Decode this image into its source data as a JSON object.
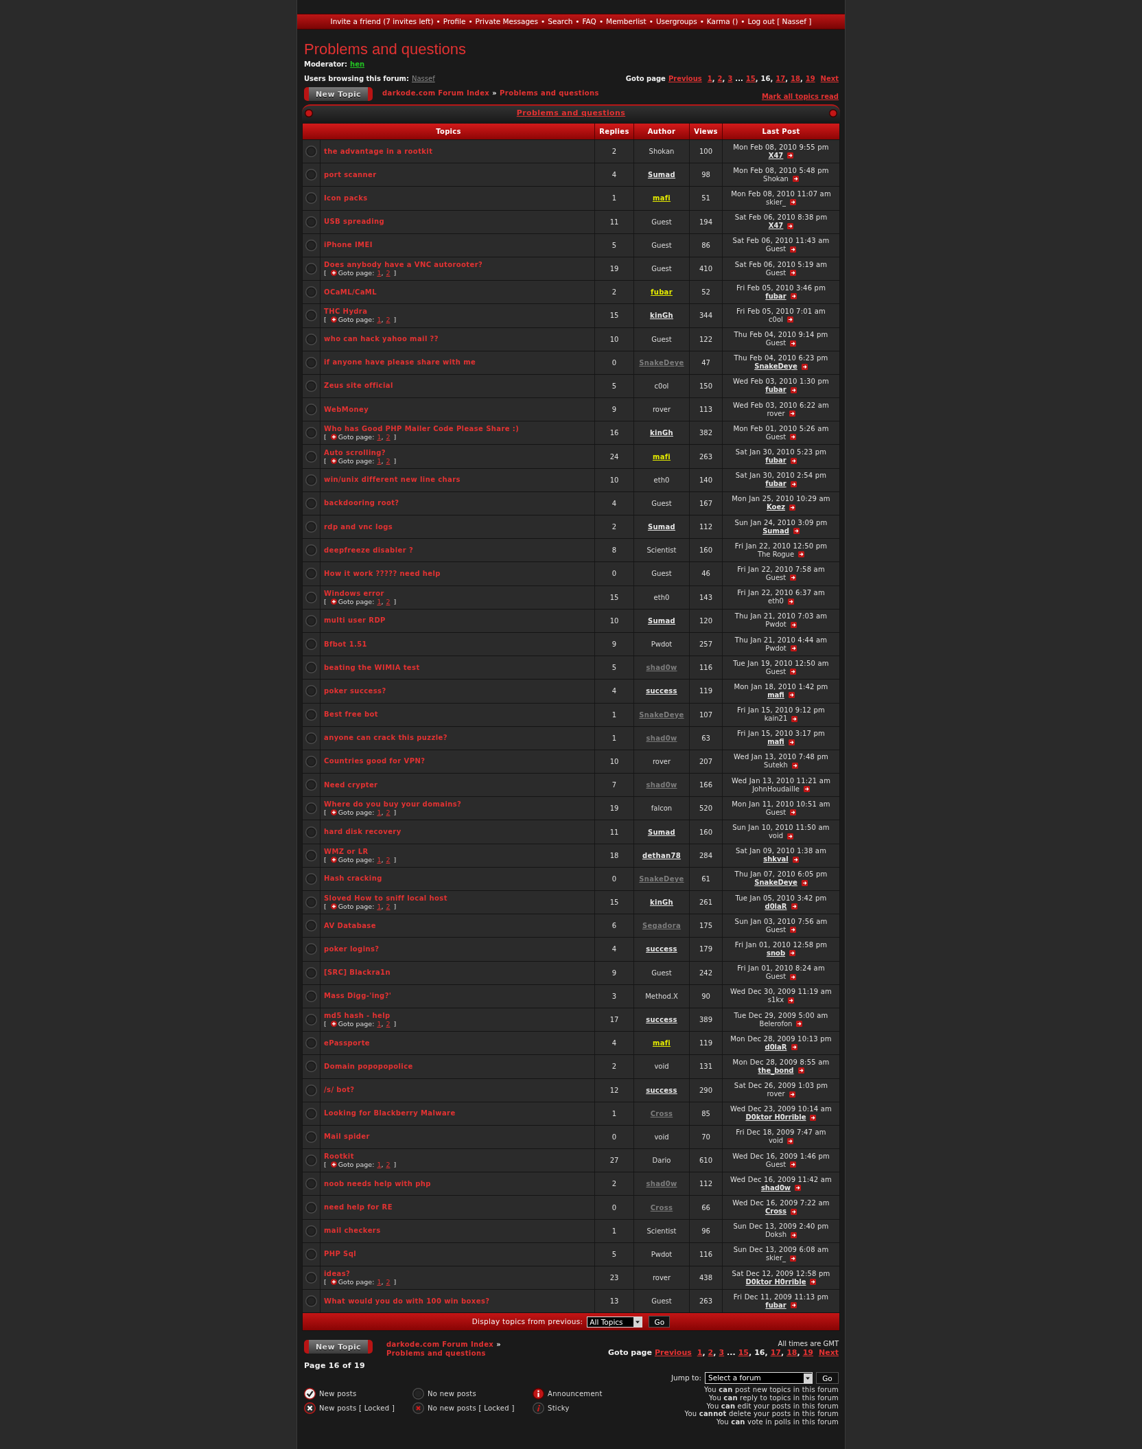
{
  "nav": {
    "links": [
      "Invite a friend (7 invites left)",
      "Profile",
      "Private Messages",
      "Search",
      "FAQ",
      "Memberlist",
      "Usergroups",
      "Karma ()",
      "Log out [ Nassef ]"
    ],
    "separator": "•"
  },
  "forum_title": "Problems and questions",
  "moderator": {
    "label": "Moderator:",
    "name": "hen"
  },
  "users_browsing": {
    "label": "Users browsing this forum:",
    "names": [
      "Nassef"
    ]
  },
  "pagination_top": {
    "label": "Goto page",
    "previous": "Previous",
    "next": "Next",
    "separator": ",",
    "items": [
      {
        "kind": "page",
        "label": "1",
        "selected": false
      },
      {
        "kind": "page",
        "label": "2",
        "selected": false
      },
      {
        "kind": "page",
        "label": "3",
        "selected": false
      },
      {
        "kind": "gap",
        "label": "..."
      },
      {
        "kind": "page",
        "label": "15",
        "selected": false
      },
      {
        "kind": "page",
        "label": "16",
        "selected": true
      },
      {
        "kind": "page",
        "label": "17",
        "selected": false
      },
      {
        "kind": "page",
        "label": "18",
        "selected": false
      },
      {
        "kind": "page",
        "label": "19",
        "selected": false
      }
    ]
  },
  "new_topic_top": "New Topic",
  "breadcrumb_top": {
    "items": [
      "darkode.com Forum Index",
      "Problems and questions"
    ],
    "separator": "»"
  },
  "mark_read": "Mark all topics read",
  "topics": {
    "title": "Problems and questions",
    "columns": [
      "Topics",
      "Replies",
      "Author",
      "Views",
      "Last Post"
    ],
    "rows": [
      {
        "title": "the advantage in a rootkit",
        "replies": "2",
        "author": {
          "name": "Shokan",
          "linked": false
        },
        "views": "100",
        "last_post": {
          "date": "Mon Feb 08, 2010 9:55 pm",
          "author": "X47",
          "linked": true
        }
      },
      {
        "title": "port scanner",
        "replies": "4",
        "author": {
          "name": "Sumad",
          "linked": true,
          "color": "#e6e6e6"
        },
        "views": "98",
        "last_post": {
          "date": "Mon Feb 08, 2010 5:48 pm",
          "author": "Shokan",
          "linked": false
        }
      },
      {
        "title": "Icon packs",
        "replies": "1",
        "author": {
          "name": "mafi",
          "linked": true,
          "color": "#e5ec00"
        },
        "views": "51",
        "last_post": {
          "date": "Mon Feb 08, 2010 11:07 am",
          "author": "skier_",
          "linked": false
        }
      },
      {
        "title": "USB spreading",
        "replies": "11",
        "author": {
          "name": "Guest",
          "linked": false
        },
        "views": "194",
        "last_post": {
          "date": "Sat Feb 06, 2010 8:38 pm",
          "author": "X47",
          "linked": true
        }
      },
      {
        "title": "iPhone IMEI",
        "replies": "5",
        "author": {
          "name": "Guest",
          "linked": false
        },
        "views": "86",
        "last_post": {
          "date": "Sat Feb 06, 2010 11:43 am",
          "author": "Guest",
          "linked": false
        }
      },
      {
        "title": "Does anybody have a VNC autorooter?",
        "goto": {
          "open": "[",
          "label": "Goto page:",
          "pages": [
            "1",
            "2"
          ],
          "separator": ",",
          "close": "]"
        },
        "replies": "19",
        "author": {
          "name": "Guest",
          "linked": false
        },
        "views": "410",
        "last_post": {
          "date": "Sat Feb 06, 2010 5:19 am",
          "author": "Guest",
          "linked": false
        }
      },
      {
        "title": "OCaML/CaML",
        "replies": "2",
        "author": {
          "name": "fubar",
          "linked": true,
          "color": "#e5ec00"
        },
        "views": "52",
        "last_post": {
          "date": "Fri Feb 05, 2010 3:46 pm",
          "author": "fubar",
          "linked": true
        }
      },
      {
        "title": "THC Hydra",
        "goto": {
          "open": "[",
          "label": "Goto page:",
          "pages": [
            "1",
            "2"
          ],
          "separator": ",",
          "close": "]"
        },
        "replies": "15",
        "author": {
          "name": "kinGh",
          "linked": true,
          "color": "#e6e6e6"
        },
        "views": "344",
        "last_post": {
          "date": "Fri Feb 05, 2010 7:01 am",
          "author": "c0ol",
          "linked": false
        }
      },
      {
        "title": "who can hack yahoo mail ??",
        "replies": "10",
        "author": {
          "name": "Guest",
          "linked": false
        },
        "views": "122",
        "last_post": {
          "date": "Thu Feb 04, 2010 9:14 pm",
          "author": "Guest",
          "linked": false
        }
      },
      {
        "title": "if anyone have please share with me",
        "replies": "0",
        "author": {
          "name": "SnakeDeye",
          "linked": true,
          "color": "#7c7c7c"
        },
        "views": "47",
        "last_post": {
          "date": "Thu Feb 04, 2010 6:23 pm",
          "author": "SnakeDeye",
          "linked": true
        }
      },
      {
        "title": "Zeus site official",
        "replies": "5",
        "author": {
          "name": "c0ol",
          "linked": false
        },
        "views": "150",
        "last_post": {
          "date": "Wed Feb 03, 2010 1:30 pm",
          "author": "fubar",
          "linked": true
        }
      },
      {
        "title": "WebMoney",
        "replies": "9",
        "author": {
          "name": "rover",
          "linked": false
        },
        "views": "113",
        "last_post": {
          "date": "Wed Feb 03, 2010 6:22 am",
          "author": "rover",
          "linked": false
        }
      },
      {
        "title": "Who has Good PHP Mailer Code Please Share :)",
        "goto": {
          "open": "[",
          "label": "Goto page:",
          "pages": [
            "1",
            "2"
          ],
          "separator": ",",
          "close": "]"
        },
        "replies": "16",
        "author": {
          "name": "kinGh",
          "linked": true,
          "color": "#e6e6e6"
        },
        "views": "382",
        "last_post": {
          "date": "Mon Feb 01, 2010 5:26 am",
          "author": "Guest",
          "linked": false
        }
      },
      {
        "title": "Auto scrolling?",
        "goto": {
          "open": "[",
          "label": "Goto page:",
          "pages": [
            "1",
            "2"
          ],
          "separator": ",",
          "close": "]"
        },
        "replies": "24",
        "author": {
          "name": "mafi",
          "linked": true,
          "color": "#e5ec00"
        },
        "views": "263",
        "last_post": {
          "date": "Sat Jan 30, 2010 5:23 pm",
          "author": "fubar",
          "linked": true
        }
      },
      {
        "title": "win/unix different new line chars",
        "replies": "10",
        "author": {
          "name": "eth0",
          "linked": false
        },
        "views": "140",
        "last_post": {
          "date": "Sat Jan 30, 2010 2:54 pm",
          "author": "fubar",
          "linked": true
        }
      },
      {
        "title": "backdooring root?",
        "replies": "4",
        "author": {
          "name": "Guest",
          "linked": false
        },
        "views": "167",
        "last_post": {
          "date": "Mon Jan 25, 2010 10:29 am",
          "author": "Koez",
          "linked": true
        }
      },
      {
        "title": "rdp and vnc logs",
        "replies": "2",
        "author": {
          "name": "Sumad",
          "linked": true,
          "color": "#e6e6e6"
        },
        "views": "112",
        "last_post": {
          "date": "Sun Jan 24, 2010 3:09 pm",
          "author": "Sumad",
          "linked": true
        }
      },
      {
        "title": "deepfreeze disabler ?",
        "replies": "8",
        "author": {
          "name": "Scientist",
          "linked": false
        },
        "views": "160",
        "last_post": {
          "date": "Fri Jan 22, 2010 12:50 pm",
          "author": "The Rogue",
          "linked": false
        }
      },
      {
        "title": "How it work ????? need help",
        "replies": "0",
        "author": {
          "name": "Guest",
          "linked": false
        },
        "views": "46",
        "last_post": {
          "date": "Fri Jan 22, 2010 7:58 am",
          "author": "Guest",
          "linked": false
        }
      },
      {
        "title": "Windows error",
        "goto": {
          "open": "[",
          "label": "Goto page:",
          "pages": [
            "1",
            "2"
          ],
          "separator": ",",
          "close": "]"
        },
        "replies": "15",
        "author": {
          "name": "eth0",
          "linked": false
        },
        "views": "143",
        "last_post": {
          "date": "Fri Jan 22, 2010 6:37 am",
          "author": "eth0",
          "linked": false
        }
      },
      {
        "title": "multi user RDP",
        "replies": "10",
        "author": {
          "name": "Sumad",
          "linked": true,
          "color": "#e6e6e6"
        },
        "views": "120",
        "last_post": {
          "date": "Thu Jan 21, 2010 7:03 am",
          "author": "Pwdot",
          "linked": false
        }
      },
      {
        "title": "Bfbot 1.51",
        "replies": "9",
        "author": {
          "name": "Pwdot",
          "linked": false
        },
        "views": "257",
        "last_post": {
          "date": "Thu Jan 21, 2010 4:44 am",
          "author": "Pwdot",
          "linked": false
        }
      },
      {
        "title": "beating the WIMIA test",
        "replies": "5",
        "author": {
          "name": "shad0w",
          "linked": true,
          "color": "#7c7c7c"
        },
        "views": "116",
        "last_post": {
          "date": "Tue Jan 19, 2010 12:50 am",
          "author": "Guest",
          "linked": false
        }
      },
      {
        "title": "poker success?",
        "replies": "4",
        "author": {
          "name": "success",
          "linked": true,
          "color": "#e6e6e6"
        },
        "views": "119",
        "last_post": {
          "date": "Mon Jan 18, 2010 1:42 pm",
          "author": "mafi",
          "linked": true
        }
      },
      {
        "title": "Best free bot",
        "replies": "1",
        "author": {
          "name": "SnakeDeye",
          "linked": true,
          "color": "#7c7c7c"
        },
        "views": "107",
        "last_post": {
          "date": "Fri Jan 15, 2010 9:12 pm",
          "author": "kain21",
          "linked": false
        }
      },
      {
        "title": "anyone can crack this puzzle?",
        "replies": "1",
        "author": {
          "name": "shad0w",
          "linked": true,
          "color": "#7c7c7c"
        },
        "views": "63",
        "last_post": {
          "date": "Fri Jan 15, 2010 3:17 pm",
          "author": "mafi",
          "linked": true
        }
      },
      {
        "title": "Countries good for VPN?",
        "replies": "10",
        "author": {
          "name": "rover",
          "linked": false
        },
        "views": "207",
        "last_post": {
          "date": "Wed Jan 13, 2010 7:48 pm",
          "author": "Sutekh",
          "linked": false
        }
      },
      {
        "title": "Need crypter",
        "replies": "7",
        "author": {
          "name": "shad0w",
          "linked": true,
          "color": "#7c7c7c"
        },
        "views": "166",
        "last_post": {
          "date": "Wed Jan 13, 2010 11:21 am",
          "author": "JohnHoudaille",
          "linked": false
        }
      },
      {
        "title": "Where do you buy your domains?",
        "goto": {
          "open": "[",
          "label": "Goto page:",
          "pages": [
            "1",
            "2"
          ],
          "separator": ",",
          "close": "]"
        },
        "replies": "19",
        "author": {
          "name": "falcon",
          "linked": false
        },
        "views": "520",
        "last_post": {
          "date": "Mon Jan 11, 2010 10:51 am",
          "author": "Guest",
          "linked": false
        }
      },
      {
        "title": "hard disk recovery",
        "replies": "11",
        "author": {
          "name": "Sumad",
          "linked": true,
          "color": "#e6e6e6"
        },
        "views": "160",
        "last_post": {
          "date": "Sun Jan 10, 2010 11:50 am",
          "author": "void",
          "linked": false
        }
      },
      {
        "title": "WMZ or LR",
        "goto": {
          "open": "[",
          "label": "Goto page:",
          "pages": [
            "1",
            "2"
          ],
          "separator": ",",
          "close": "]"
        },
        "replies": "18",
        "author": {
          "name": "dethan78",
          "linked": true,
          "color": "#e6e6e6"
        },
        "views": "284",
        "last_post": {
          "date": "Sat Jan 09, 2010 1:38 am",
          "author": "shkval",
          "linked": true
        }
      },
      {
        "title": "Hash cracking",
        "replies": "0",
        "author": {
          "name": "SnakeDeye",
          "linked": true,
          "color": "#7c7c7c"
        },
        "views": "61",
        "last_post": {
          "date": "Thu Jan 07, 2010 6:05 pm",
          "author": "SnakeDeye",
          "linked": true
        }
      },
      {
        "title": "Sloved How to sniff local host",
        "goto": {
          "open": "[",
          "label": "Goto page:",
          "pages": [
            "1",
            "2"
          ],
          "separator": ",",
          "close": "]"
        },
        "replies": "15",
        "author": {
          "name": "kinGh",
          "linked": true,
          "color": "#e6e6e6"
        },
        "views": "261",
        "last_post": {
          "date": "Tue Jan 05, 2010 3:42 pm",
          "author": "d0laR",
          "linked": true
        }
      },
      {
        "title": "AV Database",
        "replies": "6",
        "author": {
          "name": "Segadora",
          "linked": true,
          "color": "#7c7c7c"
        },
        "views": "175",
        "last_post": {
          "date": "Sun Jan 03, 2010 7:56 am",
          "author": "Guest",
          "linked": false
        }
      },
      {
        "title": "poker logins?",
        "replies": "4",
        "author": {
          "name": "success",
          "linked": true,
          "color": "#e6e6e6"
        },
        "views": "179",
        "last_post": {
          "date": "Fri Jan 01, 2010 12:58 pm",
          "author": "snob",
          "linked": true
        }
      },
      {
        "title": "[SRC] Blackra1n",
        "replies": "9",
        "author": {
          "name": "Guest",
          "linked": false
        },
        "views": "242",
        "last_post": {
          "date": "Fri Jan 01, 2010 8:24 am",
          "author": "Guest",
          "linked": false
        }
      },
      {
        "title": "Mass Digg-'ing?'",
        "replies": "3",
        "author": {
          "name": "Method.X",
          "linked": false
        },
        "views": "90",
        "last_post": {
          "date": "Wed Dec 30, 2009 11:19 am",
          "author": "s1kx",
          "linked": false
        }
      },
      {
        "title": "md5 hash - help",
        "goto": {
          "open": "[",
          "label": "Goto page:",
          "pages": [
            "1",
            "2"
          ],
          "separator": ",",
          "close": "]"
        },
        "replies": "17",
        "author": {
          "name": "success",
          "linked": true,
          "color": "#e6e6e6"
        },
        "views": "389",
        "last_post": {
          "date": "Tue Dec 29, 2009 5:00 am",
          "author": "Belerofon",
          "linked": false
        }
      },
      {
        "title": "ePassporte",
        "replies": "4",
        "author": {
          "name": "mafi",
          "linked": true,
          "color": "#e5ec00"
        },
        "views": "119",
        "last_post": {
          "date": "Mon Dec 28, 2009 10:13 pm",
          "author": "d0laR",
          "linked": true
        }
      },
      {
        "title": "Domain popopopolice",
        "replies": "2",
        "author": {
          "name": "void",
          "linked": false
        },
        "views": "131",
        "last_post": {
          "date": "Mon Dec 28, 2009 8:55 am",
          "author": "the_bond",
          "linked": true
        }
      },
      {
        "title": "/s/ bot?",
        "replies": "12",
        "author": {
          "name": "success",
          "linked": true,
          "color": "#e6e6e6"
        },
        "views": "290",
        "last_post": {
          "date": "Sat Dec 26, 2009 1:03 pm",
          "author": "rover",
          "linked": false
        }
      },
      {
        "title": "Looking for Blackberry Malware",
        "replies": "1",
        "author": {
          "name": "Cross",
          "linked": true,
          "color": "#7c7c7c"
        },
        "views": "85",
        "last_post": {
          "date": "Wed Dec 23, 2009 10:14 am",
          "author": "D0ktor H0rrible",
          "linked": true
        }
      },
      {
        "title": "Mail spider",
        "replies": "0",
        "author": {
          "name": "void",
          "linked": false
        },
        "views": "70",
        "last_post": {
          "date": "Fri Dec 18, 2009 7:47 am",
          "author": "void",
          "linked": false
        }
      },
      {
        "title": "Rootkit",
        "goto": {
          "open": "[",
          "label": "Goto page:",
          "pages": [
            "1",
            "2"
          ],
          "separator": ",",
          "close": "]"
        },
        "replies": "27",
        "author": {
          "name": "Dario",
          "linked": false
        },
        "views": "610",
        "last_post": {
          "date": "Wed Dec 16, 2009 1:46 pm",
          "author": "Guest",
          "linked": false
        }
      },
      {
        "title": "noob needs help with php",
        "replies": "2",
        "author": {
          "name": "shad0w",
          "linked": true,
          "color": "#7c7c7c"
        },
        "views": "112",
        "last_post": {
          "date": "Wed Dec 16, 2009 11:42 am",
          "author": "shad0w",
          "linked": true
        }
      },
      {
        "title": "need help for RE",
        "replies": "0",
        "author": {
          "name": "Cross",
          "linked": true,
          "color": "#7c7c7c"
        },
        "views": "66",
        "last_post": {
          "date": "Wed Dec 16, 2009 7:22 am",
          "author": "Cross",
          "linked": true
        }
      },
      {
        "title": "mail checkers",
        "replies": "1",
        "author": {
          "name": "Scientist",
          "linked": false
        },
        "views": "96",
        "last_post": {
          "date": "Sun Dec 13, 2009 2:40 pm",
          "author": "Doksh",
          "linked": false
        }
      },
      {
        "title": "PHP Sql",
        "replies": "5",
        "author": {
          "name": "Pwdot",
          "linked": false
        },
        "views": "116",
        "last_post": {
          "date": "Sun Dec 13, 2009 6:08 am",
          "author": "skier_",
          "linked": false
        }
      },
      {
        "title": "ideas?",
        "goto": {
          "open": "[",
          "label": "Goto page:",
          "pages": [
            "1",
            "2"
          ],
          "separator": ",",
          "close": "]"
        },
        "replies": "23",
        "author": {
          "name": "rover",
          "linked": false
        },
        "views": "438",
        "last_post": {
          "date": "Sat Dec 12, 2009 12:58 pm",
          "author": "D0ktor H0rrible",
          "linked": true
        }
      },
      {
        "title": "What would you do with 100 win boxes?",
        "replies": "13",
        "author": {
          "name": "Guest",
          "linked": false
        },
        "views": "263",
        "last_post": {
          "date": "Fri Dec 11, 2009 11:13 pm",
          "author": "fubar",
          "linked": true
        }
      }
    ],
    "filter": {
      "label": "Display topics from previous:",
      "select": "All Topics",
      "button": "Go"
    }
  },
  "footer": {
    "new_topic": "New Topic",
    "breadcrumb": {
      "items": [
        "darkode.com Forum Index",
        "Problems and questions"
      ],
      "separator": "»"
    },
    "timezone": "All times are GMT",
    "pagination": {
      "label": "Goto page",
      "previous": "Previous",
      "next": "Next",
      "separator": ",",
      "items": [
        {
          "kind": "page",
          "label": "1",
          "selected": false
        },
        {
          "kind": "page",
          "label": "2",
          "selected": false
        },
        {
          "kind": "page",
          "label": "3",
          "selected": false
        },
        {
          "kind": "gap",
          "label": "..."
        },
        {
          "kind": "page",
          "label": "15",
          "selected": false
        },
        {
          "kind": "page",
          "label": "16",
          "selected": true
        },
        {
          "kind": "page",
          "label": "17",
          "selected": false
        },
        {
          "kind": "page",
          "label": "18",
          "selected": false
        },
        {
          "kind": "page",
          "label": "19",
          "selected": false
        }
      ]
    },
    "page_info": "Page 16 of 19",
    "jump": {
      "label": "Jump to:",
      "select": "Select a forum",
      "button": "Go"
    },
    "legend": [
      {
        "kind": "new",
        "label": "New posts"
      },
      {
        "kind": "none",
        "label": "No new posts"
      },
      {
        "kind": "announcement",
        "label": "Announcement"
      },
      {
        "kind": "new_locked",
        "label": "New posts [ Locked ]"
      },
      {
        "kind": "none_locked",
        "label": "No new posts [ Locked ]"
      },
      {
        "kind": "sticky",
        "label": "Sticky"
      }
    ],
    "permissions": [
      "You **can** post new topics in this forum",
      "You **can** reply to topics in this forum",
      "You **can** edit your posts in this forum",
      "You **cannot** delete your posts in this forum",
      "You **can** vote in polls in this forum"
    ]
  }
}
